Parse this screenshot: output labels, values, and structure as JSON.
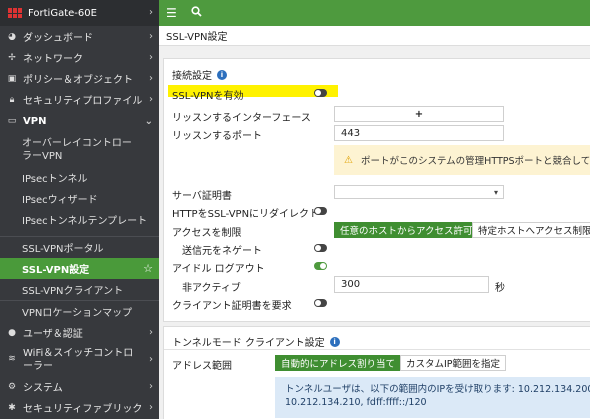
{
  "device_name": "FortiGate-60E",
  "sidebar": {
    "items": [
      {
        "label": "ダッシュボード",
        "icon": "dashboard-icon"
      },
      {
        "label": "ネットワーク",
        "icon": "network-icon"
      },
      {
        "label": "ポリシー＆オブジェクト",
        "icon": "policy-icon"
      },
      {
        "label": "セキュリティプロファイル",
        "icon": "lock-icon"
      },
      {
        "label": "VPN",
        "icon": "monitor-icon"
      }
    ],
    "vpn_sub": [
      {
        "label": "オーバーレイコントローラーVPN"
      },
      {
        "label": "IPsecトンネル"
      },
      {
        "label": "IPsecウィザード"
      },
      {
        "label": "IPsecトンネルテンプレート"
      },
      {
        "label": "SSL-VPNポータル"
      },
      {
        "label": "SSL-VPN設定"
      },
      {
        "label": "SSL-VPNクライアント"
      },
      {
        "label": "VPNロケーションマップ"
      }
    ],
    "bottom_items": [
      {
        "label": "ユーザ＆認証",
        "icon": "user-icon"
      },
      {
        "label": "WiFi＆スイッチコントローラー",
        "icon": "wifi-icon"
      },
      {
        "label": "システム",
        "icon": "gear-icon"
      },
      {
        "label": "セキュリティファブリック",
        "icon": "fabric-icon"
      }
    ]
  },
  "topbar": {
    "menu_icon": "hamburger-icon",
    "search_icon": "search-icon"
  },
  "page_title": "SSL-VPN設定",
  "connection": {
    "section_title": "接続設定",
    "enable_label": "SSL-VPNを有効",
    "listen_interface_label": "リッスンするインターフェース",
    "listen_interface_add": "+",
    "listen_port_label": "リッスンするポート",
    "listen_port_value": "443",
    "warning_text": "ポートがこのシステムの管理HTTPSポートと競合してい",
    "server_cert_label": "サーバ証明書",
    "redirect_label": "HTTPをSSL-VPNにリダイレクト",
    "access_label": "アクセスを制限",
    "access_opt_any": "任意のホストからアクセス許可",
    "access_opt_specific": "特定ホストへアクセス制限",
    "negate_source_label": "送信元をネゲート",
    "idle_logout_label": "アイドル ログアウト",
    "inactive_label": "非アクティブ",
    "inactive_value": "300",
    "inactive_unit": "秒",
    "client_cert_label": "クライアント証明書を要求"
  },
  "tunnel": {
    "section_title": "トンネルモード クライアント設定",
    "address_range_label": "アドレス範囲",
    "opt_auto": "自動的にアドレス割り当て",
    "opt_custom": "カスタムIP範囲を指定",
    "note_line1": "トンネルユーザは、以下の範囲内のIPを受け取ります: 10.212.134.200 -",
    "note_line2": "10.212.134.210, fdff:ffff::/120"
  },
  "colors": {
    "accent": "#4e9a3e",
    "sidebar_bg": "#37393d",
    "highlight": "#fff200"
  }
}
